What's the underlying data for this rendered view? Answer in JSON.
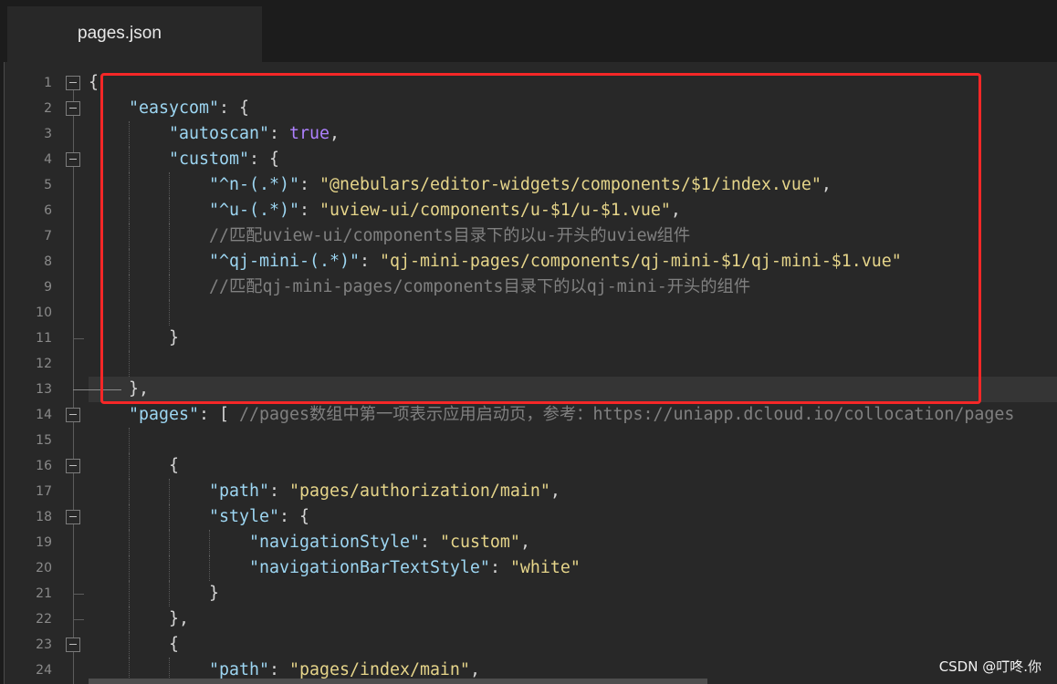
{
  "tabs": [
    {
      "label": "pages.json",
      "active": true
    }
  ],
  "editor": {
    "current_line": "13",
    "colors": {
      "tab_bar": "#1c1c1c",
      "background": "#282828",
      "current_line": "#353535",
      "line_number": "#8a8a8a",
      "key": "#9dd6f2",
      "string": "#e6d58a",
      "bool": "#ae81ff",
      "punct": "#d6d6d6",
      "comment": "#808080",
      "annotation": "#f52727"
    },
    "lines": [
      {
        "num": "1",
        "indent": 0,
        "fold": "open",
        "tokens": [
          [
            "punct",
            "{"
          ]
        ]
      },
      {
        "num": "2",
        "indent": 1,
        "fold": "open",
        "tokens": [
          [
            "key",
            "\"easycom\""
          ],
          [
            "punct",
            ": {"
          ]
        ]
      },
      {
        "num": "3",
        "indent": 2,
        "tokens": [
          [
            "key",
            "\"autoscan\""
          ],
          [
            "punct",
            ": "
          ],
          [
            "bool",
            "true"
          ],
          [
            "punct",
            ","
          ]
        ]
      },
      {
        "num": "4",
        "indent": 2,
        "fold": "open",
        "tokens": [
          [
            "key",
            "\"custom\""
          ],
          [
            "punct",
            ": {"
          ]
        ]
      },
      {
        "num": "5",
        "indent": 3,
        "tokens": [
          [
            "key",
            "\"^n-(.*)\""
          ],
          [
            "punct",
            ": "
          ],
          [
            "string",
            "\"@nebulars/editor-widgets/components/$1/index.vue\""
          ],
          [
            "punct",
            ","
          ]
        ]
      },
      {
        "num": "6",
        "indent": 3,
        "tokens": [
          [
            "key",
            "\"^u-(.*)\""
          ],
          [
            "punct",
            ": "
          ],
          [
            "string",
            "\"uview-ui/components/u-$1/u-$1.vue\""
          ],
          [
            "punct",
            ","
          ]
        ]
      },
      {
        "num": "7",
        "indent": 3,
        "tokens": [
          [
            "comment",
            "//匹配uview-ui/components目录下的以u-开头的uview组件"
          ]
        ]
      },
      {
        "num": "8",
        "indent": 3,
        "tokens": [
          [
            "key",
            "\"^qj-mini-(.*)\""
          ],
          [
            "punct",
            ": "
          ],
          [
            "string",
            "\"qj-mini-pages/components/qj-mini-$1/qj-mini-$1.vue\""
          ]
        ]
      },
      {
        "num": "9",
        "indent": 3,
        "tokens": [
          [
            "comment",
            "//匹配qj-mini-pages/components目录下的以qj-mini-开头的组件"
          ]
        ]
      },
      {
        "num": "10",
        "indent": 3,
        "tokens": []
      },
      {
        "num": "11",
        "indent": 2,
        "fold": "end",
        "tokens": [
          [
            "punct",
            "}"
          ]
        ]
      },
      {
        "num": "12",
        "indent": 2,
        "tokens": []
      },
      {
        "num": "13",
        "indent": 1,
        "fold": "end",
        "tokens": [
          [
            "punct",
            "},"
          ]
        ]
      },
      {
        "num": "14",
        "indent": 1,
        "fold": "open",
        "tokens": [
          [
            "key",
            "\"pages\""
          ],
          [
            "punct",
            ": [ "
          ],
          [
            "comment",
            "//pages数组中第一项表示应用启动页，参考：https://uniapp.dcloud.io/collocation/pages"
          ]
        ]
      },
      {
        "num": "15",
        "indent": 2,
        "tokens": []
      },
      {
        "num": "16",
        "indent": 2,
        "fold": "open",
        "tokens": [
          [
            "punct",
            "{"
          ]
        ]
      },
      {
        "num": "17",
        "indent": 3,
        "tokens": [
          [
            "key",
            "\"path\""
          ],
          [
            "punct",
            ": "
          ],
          [
            "string",
            "\"pages/authorization/main\""
          ],
          [
            "punct",
            ","
          ]
        ]
      },
      {
        "num": "18",
        "indent": 3,
        "fold": "open",
        "tokens": [
          [
            "key",
            "\"style\""
          ],
          [
            "punct",
            ": {"
          ]
        ]
      },
      {
        "num": "19",
        "indent": 4,
        "tokens": [
          [
            "key",
            "\"navigationStyle\""
          ],
          [
            "punct",
            ": "
          ],
          [
            "string",
            "\"custom\""
          ],
          [
            "punct",
            ","
          ]
        ]
      },
      {
        "num": "20",
        "indent": 4,
        "tokens": [
          [
            "key",
            "\"navigationBarTextStyle\""
          ],
          [
            "punct",
            ": "
          ],
          [
            "string",
            "\"white\""
          ]
        ]
      },
      {
        "num": "21",
        "indent": 3,
        "fold": "end",
        "tokens": [
          [
            "punct",
            "}"
          ]
        ]
      },
      {
        "num": "22",
        "indent": 2,
        "fold": "end",
        "tokens": [
          [
            "punct",
            "},"
          ]
        ]
      },
      {
        "num": "23",
        "indent": 2,
        "fold": "open",
        "tokens": [
          [
            "punct",
            "{"
          ]
        ]
      },
      {
        "num": "24",
        "indent": 3,
        "tokens": [
          [
            "key",
            "\"path\""
          ],
          [
            "punct",
            ": "
          ],
          [
            "string",
            "\"pages/index/main\""
          ],
          [
            "punct",
            ","
          ]
        ]
      }
    ]
  },
  "watermark": "CSDN @叮咚.你"
}
